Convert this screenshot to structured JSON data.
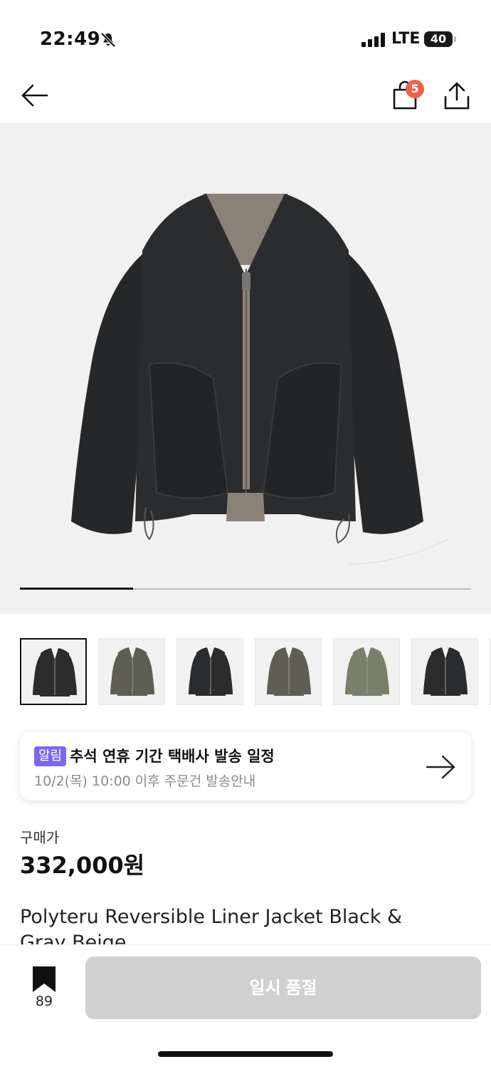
{
  "status_bar": {
    "time": "22:49",
    "network": "LTE",
    "battery": "40"
  },
  "nav": {
    "cart_count": "5"
  },
  "gallery": {
    "current_index": 1,
    "total": 6,
    "progress_fraction": 0.25
  },
  "thumbnails": [
    {
      "name": "thumb-1",
      "variant": "black"
    },
    {
      "name": "thumb-2",
      "variant": "olive-gray"
    },
    {
      "name": "thumb-3",
      "variant": "black"
    },
    {
      "name": "thumb-4",
      "variant": "olive-gray"
    },
    {
      "name": "thumb-5",
      "variant": "sage"
    },
    {
      "name": "thumb-6",
      "variant": "black"
    }
  ],
  "notice": {
    "badge": "알림",
    "title": "추석 연휴 기간 택배사 발송 일정",
    "subtitle": "10/2(목) 10:00 이후 주문건 발송안내"
  },
  "product": {
    "price_label": "구매가",
    "price": "332,000원",
    "name": "Polyteru Reversible Liner Jacket Black & Gray Beige"
  },
  "bottom": {
    "bookmark_count": "89",
    "cta_label": "일시 품절"
  },
  "colors": {
    "accent_badge": "#7b68ee",
    "cart_badge": "#f0604d",
    "soldout_button": "#d0d0d0",
    "image_bg": "#f1f1f1"
  },
  "icons": [
    "bell-off-icon",
    "signal-icon",
    "battery-icon",
    "back-arrow-icon",
    "shopping-bag-icon",
    "share-icon",
    "arrow-right-icon",
    "bookmark-icon"
  ]
}
